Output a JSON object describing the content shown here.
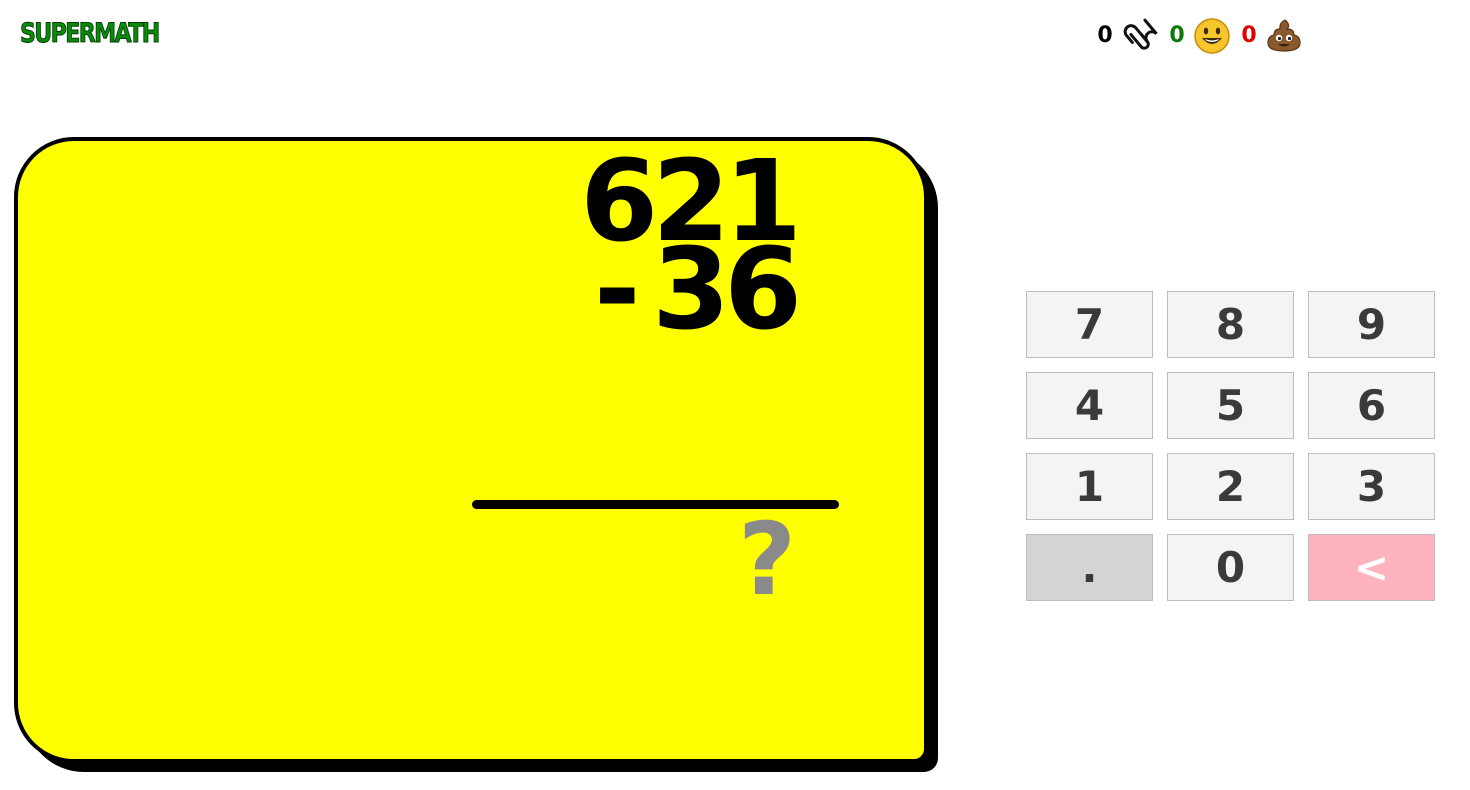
{
  "header": {
    "logo": "SUPERMATH"
  },
  "score": {
    "total": "0",
    "correct": "0",
    "wrong": "0",
    "total_icon": "paperclip-icon",
    "correct_icon": "smiley-icon",
    "wrong_icon": "poop-icon"
  },
  "problem": {
    "top_number": "621",
    "operator": "-",
    "bottom_number": "36",
    "answer": "?"
  },
  "keypad": {
    "keys": [
      "7",
      "8",
      "9",
      "4",
      "5",
      "6",
      "1",
      "2",
      "3",
      ".",
      "0",
      "<"
    ]
  },
  "colors": {
    "card": "#ffff00",
    "logo": "#0a8a0a",
    "correct": "#0b7a0b",
    "wrong": "#e00000",
    "answer": "#8a8a8a",
    "backspace": "#ffb3bf"
  }
}
